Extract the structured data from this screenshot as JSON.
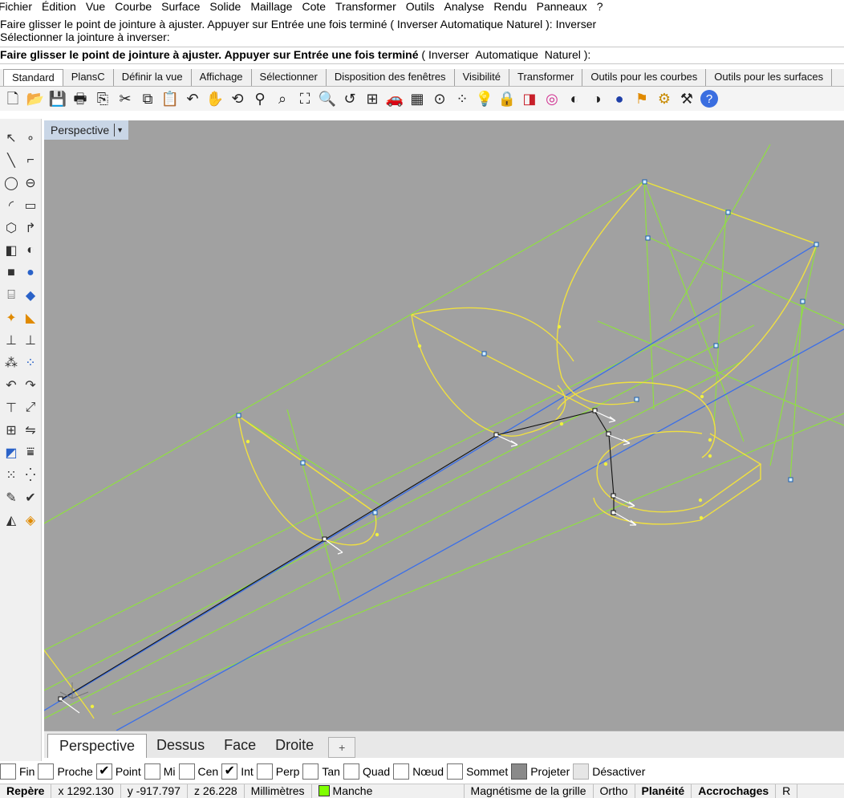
{
  "menu": [
    "Fichier",
    "Édition",
    "Vue",
    "Courbe",
    "Surface",
    "Solide",
    "Maillage",
    "Cote",
    "Transformer",
    "Outils",
    "Analyse",
    "Rendu",
    "Panneaux",
    "?"
  ],
  "history": [
    "Faire glisser le point de jointure à ajuster. Appuyer sur Entrée une fois terminé ( Inverser  Automatique  Naturel ): Inverser",
    "Sélectionner la jointure à inverser:"
  ],
  "command": {
    "prompt": "Faire glisser le point de jointure à ajuster. Appuyer sur Entrée une fois terminé",
    "open": " ( ",
    "opt1": "Inverser",
    "opt2": "Automatique",
    "opt3": "Naturel",
    "close": " ):"
  },
  "tabs": [
    "Standard",
    "PlansC",
    "Définir la vue",
    "Affichage",
    "Sélectionner",
    "Disposition des fenêtres",
    "Visibilité",
    "Transformer",
    "Outils pour les courbes",
    "Outils pour les surfaces"
  ],
  "toolbar_icons": [
    "new-file-icon",
    "open-folder-icon",
    "save-icon",
    "print-icon",
    "import-icon",
    "cut-icon",
    "copy-icon",
    "paste-icon",
    "undo-icon",
    "pan-hand-icon",
    "rotate-view-icon",
    "zoom-icon",
    "zoom-window-icon",
    "zoom-extents-icon",
    "zoom-selected-icon",
    "undo-view-icon",
    "four-viewports-icon",
    "car-icon",
    "grid-icon",
    "osnap-icon",
    "points-icon",
    "light-bulb-icon",
    "lock-icon",
    "layer-icon",
    "color-wheel-icon",
    "shade-sphere-icon",
    "rendered-sphere-icon",
    "blue-sphere-icon",
    "lamp-icon",
    "gear-icon",
    "tools-icon",
    "help-icon"
  ],
  "viewport": {
    "title": "Perspective"
  },
  "viewtabs": [
    "Perspective",
    "Dessus",
    "Face",
    "Droite"
  ],
  "viewtab_add": "+",
  "osnaps": [
    {
      "label": "Fin",
      "state": "off"
    },
    {
      "label": "Proche",
      "state": "off"
    },
    {
      "label": "Point",
      "state": "on"
    },
    {
      "label": "Mi",
      "state": "off"
    },
    {
      "label": "Cen",
      "state": "off"
    },
    {
      "label": "Int",
      "state": "on"
    },
    {
      "label": "Perp",
      "state": "off"
    },
    {
      "label": "Tan",
      "state": "off"
    },
    {
      "label": "Quad",
      "state": "off"
    },
    {
      "label": "Nœud",
      "state": "off"
    },
    {
      "label": "Sommet",
      "state": "off"
    },
    {
      "label": "Projeter",
      "state": "grey"
    },
    {
      "label": "Désactiver",
      "state": "light"
    }
  ],
  "status": {
    "frame": "Repère",
    "x": "x 1292.130",
    "y": "y -917.797",
    "z": "z 26.228",
    "units": "Millimètres",
    "layer": "Manche",
    "layer_color": "#7fff00",
    "grid_snap": "Magnétisme de la grille",
    "ortho": "Ortho",
    "planar": "Planéité",
    "osnap": "Accrochages",
    "record": "R"
  }
}
